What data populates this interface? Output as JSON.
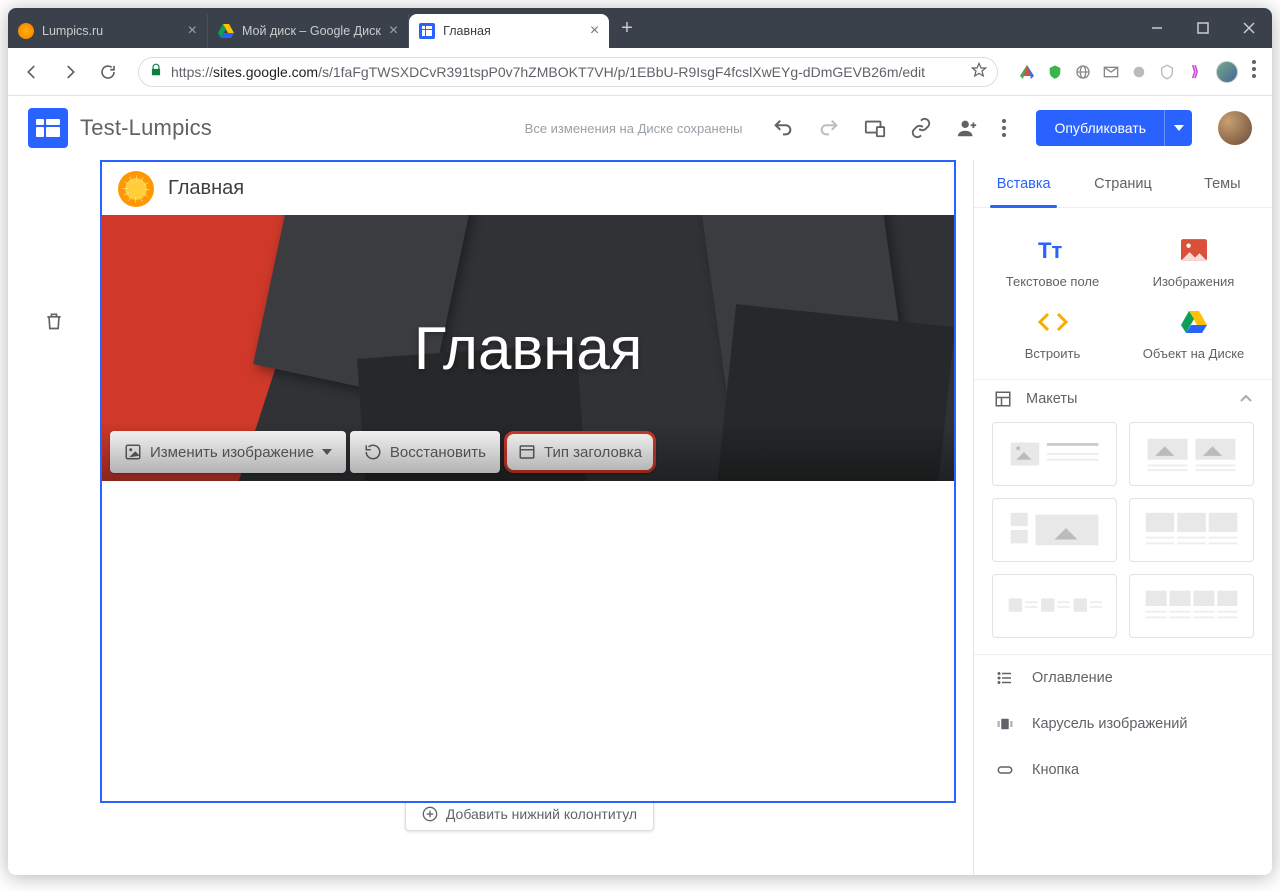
{
  "browser": {
    "tabs": [
      {
        "title": "Lumpics.ru",
        "favicon": "orange"
      },
      {
        "title": "Мой диск – Google Диск",
        "favicon": "drive"
      },
      {
        "title": "Главная",
        "favicon": "sites",
        "active": true
      }
    ],
    "url_protocol": "https://",
    "url_host": "sites.google.com",
    "url_path": "/s/1faFgTWSXDCvR391tspP0v7hZMBOKT7VH/p/1EBbU-R9IsgF4fcslXwEYg-dDmGEVB26m/edit"
  },
  "sites": {
    "site_title": "Test-Lumpics",
    "save_status": "Все изменения на Диске сохранены",
    "publish": "Опубликовать"
  },
  "page": {
    "header_title": "Главная",
    "hero_title": "Главная",
    "hero_toolbar": {
      "change_image": "Изменить изображение",
      "restore": "Восстановить",
      "header_type": "Тип заголовка"
    },
    "add_footer": "Добавить нижний колонтитул"
  },
  "panel": {
    "tabs": {
      "insert": "Вставка",
      "pages": "Страниц",
      "themes": "Темы"
    },
    "insert": {
      "text_box": "Текстовое поле",
      "images": "Изображения",
      "embed": "Встроить",
      "drive": "Объект на Диске"
    },
    "layouts_header": "Макеты",
    "list": {
      "toc": "Оглавление",
      "carousel": "Карусель изображений",
      "button": "Кнопка"
    }
  },
  "colors": {
    "accent": "#2962ff",
    "highlight": "#d0392a"
  }
}
